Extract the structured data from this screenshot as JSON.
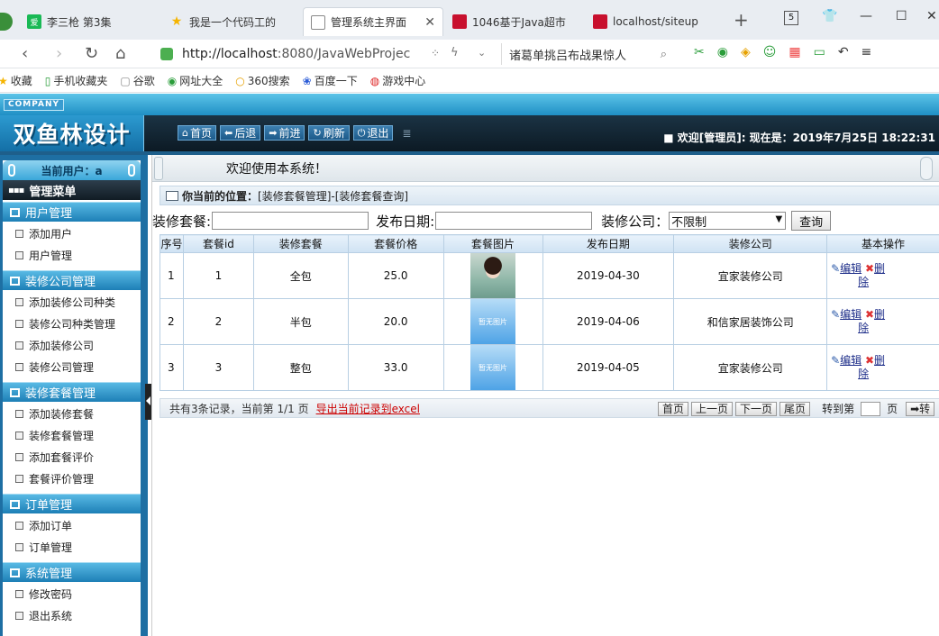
{
  "browser": {
    "tabs": [
      {
        "title": "李三枪 第3集",
        "fav": "iqiyi-icon",
        "color": "#19b955"
      },
      {
        "title": "我是一个代码工的",
        "fav": "star-icon",
        "color": "#f5b400"
      },
      {
        "title": "管理系统主界面",
        "fav": "page-icon",
        "color": "#888888",
        "active": true
      },
      {
        "title": "1046基于Java超市",
        "fav": "csdn-icon",
        "color": "#c8102e"
      },
      {
        "title": "localhost/siteup",
        "fav": "csdn-icon",
        "color": "#c8102e"
      }
    ],
    "new_tab": "+",
    "tab_count": "5",
    "url_host": "http://localhost",
    "url_rest": ":8080/JavaWebProjec",
    "search_text": "诸葛单挑吕布战果惊人",
    "bookmarks": [
      {
        "label": "收藏",
        "icon": "star-icon"
      },
      {
        "label": "手机收藏夹",
        "icon": "phone-icon"
      },
      {
        "label": "谷歌",
        "icon": "page-icon"
      },
      {
        "label": "网址大全",
        "icon": "compass-icon"
      },
      {
        "label": "360搜索",
        "icon": "360-icon"
      },
      {
        "label": "百度一下",
        "icon": "paw-icon"
      },
      {
        "label": "游戏中心",
        "icon": "game-icon"
      }
    ]
  },
  "header": {
    "company": "COMPANY",
    "logo": "双鱼林设计",
    "nav": [
      {
        "label": "首页",
        "icon": "home-icon"
      },
      {
        "label": "后退",
        "icon": "back-icon"
      },
      {
        "label": "前进",
        "icon": "forward-icon"
      },
      {
        "label": "刷新",
        "icon": "refresh-icon"
      },
      {
        "label": "退出",
        "icon": "power-icon"
      }
    ],
    "welcome": "■ 欢迎[管理员]:  现在是：2019年7月25日 18:22:31"
  },
  "sidebar": {
    "current_user": "当前用户：a",
    "menu_title": "管理菜单",
    "groups": [
      {
        "title": "用户管理",
        "items": [
          "添加用户",
          "用户管理"
        ]
      },
      {
        "title": "装修公司管理",
        "items": [
          "添加装修公司种类",
          "装修公司种类管理",
          "添加装修公司",
          "装修公司管理"
        ]
      },
      {
        "title": "装修套餐管理",
        "items": [
          "添加装修套餐",
          "装修套餐管理",
          "添加套餐评价",
          "套餐评价管理"
        ]
      },
      {
        "title": "订单管理",
        "items": [
          "添加订单",
          "订单管理"
        ]
      },
      {
        "title": "系统管理",
        "items": [
          "修改密码",
          "退出系统"
        ]
      }
    ]
  },
  "content": {
    "welcome": "欢迎使用本系统！",
    "location_label": "你当前的位置：",
    "location_path": "[装修套餐管理]-[装修套餐查询]",
    "search": {
      "pkg_label": "装修套餐:",
      "date_label": "发布日期:",
      "company_label": "装修公司：",
      "company_value": "不限制",
      "query_button": "查询"
    },
    "table": {
      "headers": [
        "序号",
        "套餐id",
        "装修套餐",
        "套餐价格",
        "套餐图片",
        "发布日期",
        "装修公司",
        "基本操作"
      ],
      "rows": [
        {
          "no": "1",
          "id": "1",
          "name": "全包",
          "price": "25.0",
          "image": "photo",
          "date": "2019-04-30",
          "company": "宜家装修公司"
        },
        {
          "no": "2",
          "id": "2",
          "name": "半包",
          "price": "20.0",
          "image": "none",
          "date": "2019-04-06",
          "company": "和信家居装饰公司"
        },
        {
          "no": "3",
          "id": "3",
          "name": "整包",
          "price": "33.0",
          "image": "none",
          "date": "2019-04-05",
          "company": "宜家装修公司"
        }
      ],
      "edit_label": "编辑",
      "delete_label": "删除",
      "delete_label_top": "删",
      "delete_label_bottom": "除",
      "no_image_text": "暂无图片"
    },
    "pager": {
      "summary": "共有3条记录，当前第 1/1 页",
      "export": "导出当前记录到excel",
      "first": "首页",
      "prev": "上一页",
      "next": "下一页",
      "last": "尾页",
      "goto_prefix": "转到第",
      "goto_suffix": "页",
      "go": "➡转"
    }
  }
}
